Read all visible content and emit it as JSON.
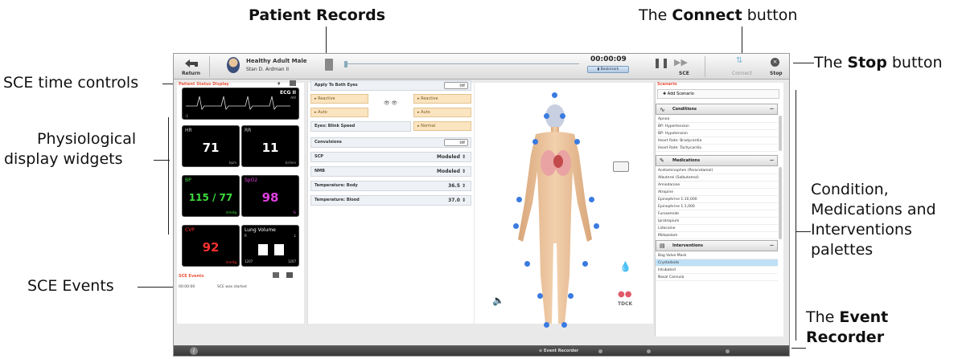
{
  "annotations": {
    "patient_records": "Patient Records",
    "connect_pre": "The ",
    "connect_bold": "Connect",
    "connect_post": " button",
    "stop_pre": "The ",
    "stop_bold": "Stop",
    "stop_post": " button",
    "sce_time": "SCE time controls",
    "physio_1": "Physiological",
    "physio_2": "display widgets",
    "palettes_1": "Condition,",
    "palettes_2": "Medications and",
    "palettes_3": "Interventions",
    "palettes_4": "palettes",
    "sce_events": "SCE Events",
    "event_pre": "The ",
    "event_bold_1": "Event",
    "event_bold_2": "Recorder"
  },
  "topbar": {
    "return_label": "Return",
    "patient_name": "Healthy Adult Male",
    "patient_sub": "Stan D. Ardman II",
    "timer": "00:00:09",
    "bookmark": "Bookmark",
    "sce_label": "SCE",
    "connect_label": "Connect",
    "stop_label": "Stop"
  },
  "left": {
    "status_title": "Patient Status Display",
    "ecg_label": "ECG II",
    "ecg_unit": "mV",
    "ecg_scale": "-1",
    "hr_label": "HR",
    "hr_value": "71",
    "hr_unit": "bpm",
    "rr_label": "RR",
    "rr_value": "11",
    "rr_unit": "br/min",
    "bp_label": "BP",
    "bp_value": "115 / 77",
    "bp_unit": "mmHg",
    "spo2_label": "SpO2",
    "spo2_value": "98",
    "spo2_unit": "%",
    "cvp_label": "CVP",
    "cvp_value": "92",
    "cvp_unit": "mmHg",
    "lung_label": "Lung Volume",
    "lung_r": "R",
    "lung_l": "L",
    "lung_rv": "1207",
    "lung_lv": "1207",
    "events_title": "SCE Events",
    "event_time": "00:00:00",
    "event_text": "SCE was started"
  },
  "middle": {
    "apply_both": "Apply To Both Eyes",
    "off": "Off",
    "reactive_l": "Reactive",
    "reactive_r": "Reactive",
    "auto_l": "Auto",
    "auto_r": "Auto",
    "blink_label": "Eyes: Blink Speed",
    "blink_value": "Normal",
    "convulsions": "Convulsions",
    "scp_label": "SCP",
    "scp_value": "Modeled",
    "nmb_label": "NMB",
    "nmb_value": "Modeled",
    "temp_body_label": "Temperature: Body",
    "temp_body_value": "36.5",
    "temp_blood_label": "Temperature: Blood",
    "temp_blood_value": "37.0"
  },
  "center": {
    "tdck": "TDCK"
  },
  "right": {
    "scenario": "Scenario",
    "add_scenario": "Add Scenario",
    "conditions_title": "Conditions",
    "conditions": [
      "Apnea",
      "BP: Hypertension",
      "BP: Hypotension",
      "Heart Rate: Bradycardia",
      "Heart Rate: Tachycardia"
    ],
    "medications_title": "Medications",
    "medications": [
      "Acetaminophen (Paracetamol)",
      "Albuterol (Salbutamol)",
      "Amiodarone",
      "Atropine",
      "Epinephrine 1:10,000",
      "Epinephrine 1:1,000",
      "Furosemide",
      "Ipratropium",
      "Lidocaine",
      "Midazolam"
    ],
    "interventions_title": "Interventions",
    "interventions": [
      "Bag Valve Mask",
      "Crystalloids",
      "Intubated",
      "Nasal Cannula"
    ]
  },
  "bottom": {
    "event_recorder": "Event Recorder"
  },
  "colors": {
    "hr": "#ffffff",
    "bp": "#3ddc3d",
    "spo2": "#e040e0",
    "cvp": "#ff3030",
    "accent": "#3a7be0"
  }
}
